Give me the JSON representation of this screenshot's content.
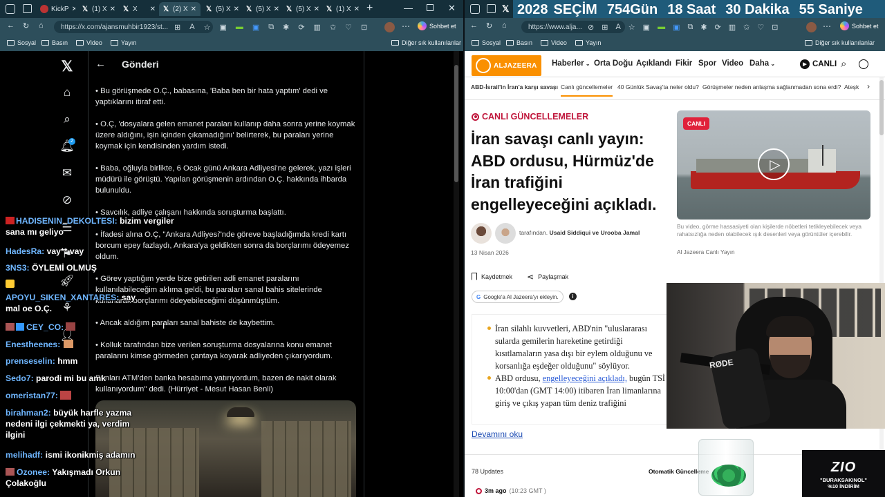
{
  "left_browser": {
    "tabs": [
      {
        "label": "KickP",
        "icon": "kick-icon"
      },
      {
        "label": "(1) X",
        "icon": "x-icon"
      },
      {
        "label": "X",
        "icon": "x-icon"
      },
      {
        "label": "(2) X",
        "icon": "x-icon"
      },
      {
        "label": "(5) X",
        "icon": "x-icon"
      },
      {
        "label": "(5) X",
        "icon": "x-icon"
      },
      {
        "label": "(5) X",
        "icon": "x-icon"
      },
      {
        "label": "(1) X",
        "icon": "x-icon"
      }
    ],
    "url": "https://x.com/ajansmuhbir1923/st...",
    "copilot": "Sohbet et",
    "bookmarks": [
      "Sosyal",
      "Basın",
      "Video",
      "Yayın"
    ],
    "other_bookmarks": "Diğer sık kullanılanlar"
  },
  "x_page": {
    "header_title": "Gönderi",
    "notification_count": "2",
    "paragraphs": [
      "• Bu görüşmede O.Ç., babasına, 'Baba ben bir hata yaptım' dedi ve yaptıklarını itiraf etti.",
      "• O.Ç, 'dosyalara gelen emanet paraları kullanıp daha sonra yerine koymak üzere aldığını, işin içinden çıkamadığını' belirterek, bu paraları yerine koymak için kendisinden yardım istedi.",
      "• Baba, oğluyla birlikte, 6 Ocak günü Ankara Adliyesi'ne gelerek, yazı işleri müdürü ile görüştü. Yapılan görüşmenin ardından O.Ç. hakkında ihbarda bulunuldu.",
      "• Savcılık, adliye çalışanı hakkında soruşturma başlattı.",
      "• İfadesi alına O.Ç, \"Ankara Adliyesi\"nde göreve başladığımda kredi kartı borcum epey fazlaydı, Ankara'ya geldikten sonra da borçlarımı ödeyemez oldum.",
      "• Görev yaptığım yerde bize getirilen adli emanet paralarını kullanılabileceğim aklıma geldi, bu paraları sanal bahis sitelerinde kullanarak borçlarımı ödeyebileceğimi düşünmüştüm.",
      "• Ancak aldığım paraları sanal bahiste de kaybettim.",
      "• Kolluk tarafından bize verilen soruşturma dosyalarına konu emanet paralarını kimse görmeden çantaya koyarak adliyeden çıkarıyordum.",
      "Bunları ATM'den banka hesabıma yatırıyordum, bazen de nakit olarak kullanıyordum\" dedi. (Hürriyet - Mesut Hasan Benli)"
    ]
  },
  "chat": [
    {
      "user": "HADISENIN_DEKOLTESI:",
      "msg": "bizim vergiler sana mı geliyo"
    },
    {
      "user": "HadesRa:",
      "msg": "vay** vay"
    },
    {
      "user": "3NS3:",
      "msg": "ÖYLEMİ OLMUŞ"
    },
    {
      "user": "APOYU_SIKEN_XANTARES:",
      "msg": "say mal oe O.Ç."
    },
    {
      "user": "CEY_CO:",
      "msg": ""
    },
    {
      "user": "Enestheenes:",
      "msg": ""
    },
    {
      "user": "prenseselin:",
      "msg": "hmm"
    },
    {
      "user": "Sedo7:",
      "msg": "parodi mi bu amk"
    },
    {
      "user": "omeristan77:",
      "msg": ""
    },
    {
      "user": "birahman2:",
      "msg": "büyük harfle yazma nedeni ilgi çekmekti ya, verdim ilgini"
    },
    {
      "user": "melihadf:",
      "msg": "ismi ikonikmiş adamın"
    },
    {
      "user": "Ozonee:",
      "msg": "Yakışmadı Orkun Çolakoğlu"
    }
  ],
  "right_browser": {
    "countdown": {
      "year": "2028",
      "label": "SEÇİM",
      "days": "754",
      "days_unit": "Gün",
      "hours": "18",
      "hours_unit": "Saat",
      "minutes": "30",
      "minutes_unit": "Dakika",
      "seconds": "55",
      "seconds_unit": "Saniye"
    },
    "url": "https://www.alja...",
    "copilot": "Sohbet et",
    "bookmarks": [
      "Sosyal",
      "Basın",
      "Video",
      "Yayın"
    ],
    "other_bookmarks": "Diğer sık kullanılanlar"
  },
  "aj_page": {
    "brand": "ALJAZEERA",
    "nav": [
      "Haberler",
      "Orta Doğu",
      "Açıklandı",
      "Fikir",
      "Spor",
      "Video",
      "Daha"
    ],
    "live_button": "CANLI",
    "subnav": [
      "ABD-İsrail'in İran'a karşı savaşı",
      "Canlı güncellemeler",
      "40 Günlük Savaş'ta neler oldu?",
      "Görüşmeler neden anlaşma sağlanmadan sona erdi?",
      "Ateşk"
    ],
    "live_label": "CANLI GÜNCELLEMELER",
    "headline": "İran savaşı canlı yayın: ABD ordusu, Hürmüz'de İran trafiğini engelleyeceğini açıkladı.",
    "byline_prefix": "tarafından.",
    "authors": "Usaid Siddiqui ve Urooba Jamal",
    "date": "13 Nisan 2026",
    "save": "Kaydetmek",
    "share": "Paylaşmak",
    "google_pill": "Google'a Al Jazeera'yı ekleyin.",
    "video_badge": "CANLI",
    "video_caption": "Bu video, görme hassasiyeti olan kişilerde nöbetleri tetikleyebilecek veya rahatsızlığa neden olabilecek ışık desenleri veya görüntüler içerebilir.",
    "video_source": "Al Jazeera Canlı Yayın",
    "bullet1": "İran silahlı kuvvetleri, ABD'nin \"uluslararası sularda gemilerin hareketine getirdiği kısıtlamaların yasa dışı bir eylem olduğunu ve korsanlığa eşdeğer olduğunu\" söylüyor.",
    "bullet2_pre": "ABD ordusu,",
    "bullet2_link": "engelleyeceğini açıkladı,",
    "bullet2_post": "bugün TSİ 10:00'dan (GMT 14:00) itibaren İran limanlarına giriş ve çıkış yapan tüm deniz trafiğini",
    "read_more": "Devamını oku",
    "updates": "78 Updates",
    "auto_updates": "Otomatik Güncelleme",
    "time_ago": "3m ago",
    "time_detail": "(10:23 GMT )"
  },
  "overlay": {
    "mic_brand": "RØDE",
    "sponsor_logo": "ZIO",
    "sponsor_code": "\"BURAKSAKINOL\"",
    "sponsor_discount": "%10 İNDİRİM"
  },
  "colors": {
    "browser_frame": "#2d4e5b",
    "tabbar": "#152f3a",
    "x_bg": "#000000",
    "aj_brand": "#fa9000",
    "countdown_bg": "#1f5b7a",
    "live_red": "#e0213a",
    "chat_user": "#6fb6ff"
  }
}
